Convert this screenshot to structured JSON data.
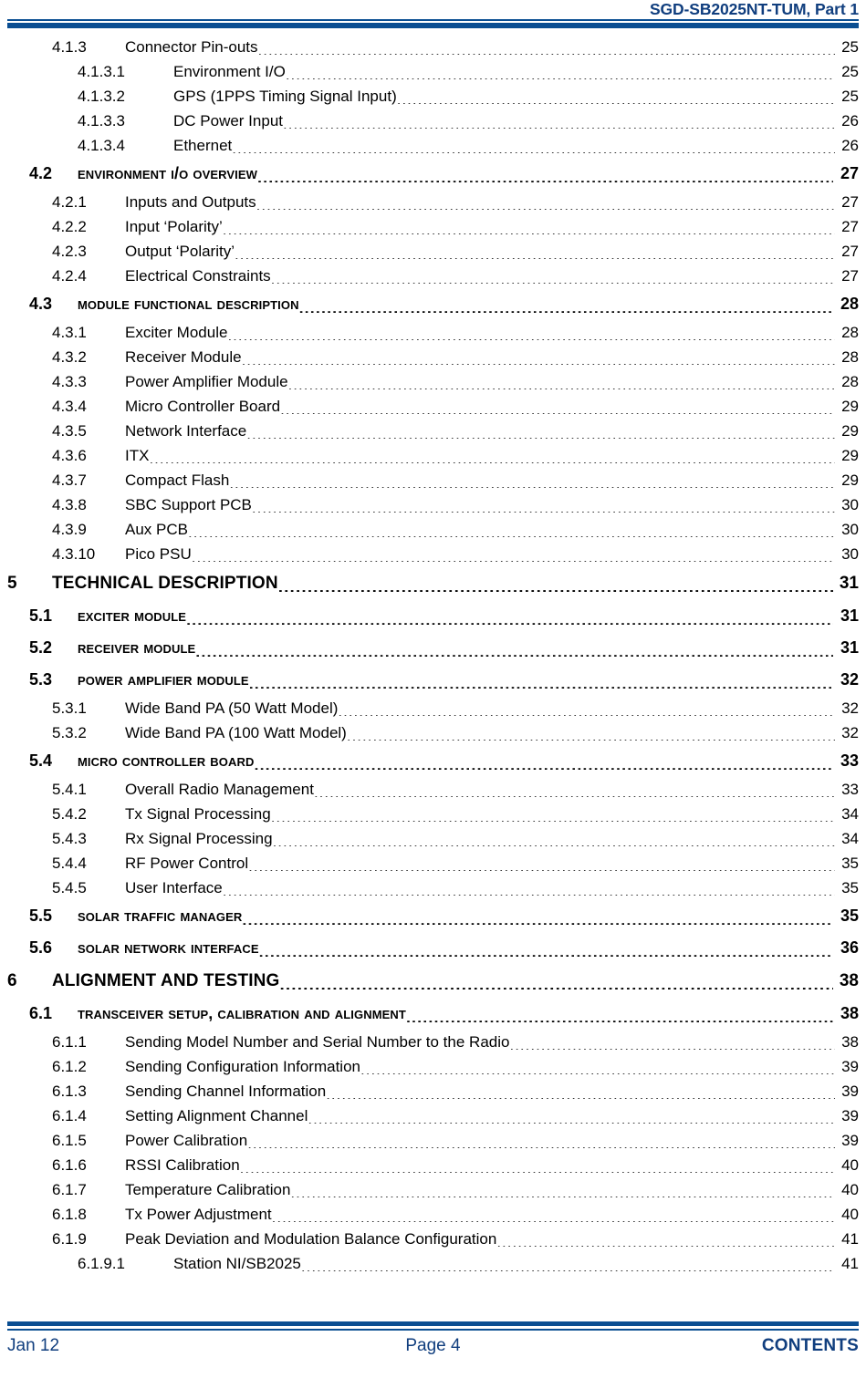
{
  "header": {
    "title": "SGD-SB2025NT-TUM, Part 1",
    "rule_color": "#0A4E92",
    "text_color": "#103E7E"
  },
  "toc": {
    "entries": [
      {
        "level": 3,
        "number": "4.1.3",
        "label": "Connector Pin-outs",
        "page": "25"
      },
      {
        "level": 4,
        "number": "4.1.3.1",
        "label": "Environment I/O",
        "page": "25"
      },
      {
        "level": 4,
        "number": "4.1.3.2",
        "label": "GPS (1PPS Timing Signal Input)",
        "page": "25"
      },
      {
        "level": 4,
        "number": "4.1.3.3",
        "label": "DC Power Input",
        "page": "26"
      },
      {
        "level": 4,
        "number": "4.1.3.4",
        "label": "Ethernet",
        "page": "26"
      },
      {
        "level": 2,
        "number": "4.2",
        "label": "Environment I/O Overview",
        "page": "27"
      },
      {
        "level": 3,
        "number": "4.2.1",
        "label": "Inputs and Outputs",
        "page": "27"
      },
      {
        "level": 3,
        "number": "4.2.2",
        "label": "Input ‘Polarity’",
        "page": "27"
      },
      {
        "level": 3,
        "number": "4.2.3",
        "label": "Output ‘Polarity’",
        "page": "27"
      },
      {
        "level": 3,
        "number": "4.2.4",
        "label": "Electrical Constraints",
        "page": "27"
      },
      {
        "level": 2,
        "number": "4.3",
        "label": "Module Functional Description",
        "page": "28"
      },
      {
        "level": 3,
        "number": "4.3.1",
        "label": "Exciter Module",
        "page": "28"
      },
      {
        "level": 3,
        "number": "4.3.2",
        "label": "Receiver Module",
        "page": "28"
      },
      {
        "level": 3,
        "number": "4.3.3",
        "label": "Power Amplifier Module",
        "page": "28"
      },
      {
        "level": 3,
        "number": "4.3.4",
        "label": "Micro Controller Board",
        "page": "29"
      },
      {
        "level": 3,
        "number": "4.3.5",
        "label": "Network Interface",
        "page": "29"
      },
      {
        "level": 3,
        "number": "4.3.6",
        "label": "ITX",
        "page": "29"
      },
      {
        "level": 3,
        "number": "4.3.7",
        "label": "Compact Flash",
        "page": "29"
      },
      {
        "level": 3,
        "number": "4.3.8",
        "label": "SBC Support PCB",
        "page": "30"
      },
      {
        "level": 3,
        "number": "4.3.9",
        "label": "Aux PCB",
        "page": "30"
      },
      {
        "level": 3,
        "number": "4.3.10",
        "label": "Pico PSU",
        "page": "30"
      },
      {
        "level": 1,
        "number": "5",
        "label": "TECHNICAL DESCRIPTION",
        "page": "31"
      },
      {
        "level": 2,
        "number": "5.1",
        "label": "Exciter Module",
        "page": "31"
      },
      {
        "level": 2,
        "number": "5.2",
        "label": "Receiver Module",
        "page": "31"
      },
      {
        "level": 2,
        "number": "5.3",
        "label": "Power Amplifier Module",
        "page": "32"
      },
      {
        "level": 3,
        "number": "5.3.1",
        "label": "Wide Band PA (50 Watt Model)",
        "page": "32"
      },
      {
        "level": 3,
        "number": "5.3.2",
        "label": "Wide Band PA (100 Watt Model)",
        "page": "32"
      },
      {
        "level": 2,
        "number": "5.4",
        "label": "Micro Controller Board",
        "page": "33"
      },
      {
        "level": 3,
        "number": "5.4.1",
        "label": "Overall Radio Management",
        "page": "33"
      },
      {
        "level": 3,
        "number": "5.4.2",
        "label": "Tx Signal Processing",
        "page": "34"
      },
      {
        "level": 3,
        "number": "5.4.3",
        "label": "Rx Signal Processing",
        "page": "34"
      },
      {
        "level": 3,
        "number": "5.4.4",
        "label": "RF Power Control",
        "page": "35"
      },
      {
        "level": 3,
        "number": "5.4.5",
        "label": "User Interface",
        "page": "35"
      },
      {
        "level": 2,
        "number": "5.5",
        "label": "Solar Traffic Manager",
        "page": "35"
      },
      {
        "level": 2,
        "number": "5.6",
        "label": "Solar Network Interface",
        "page": "36"
      },
      {
        "level": 1,
        "number": "6",
        "label": "ALIGNMENT AND TESTING",
        "page": "38"
      },
      {
        "level": 2,
        "number": "6.1",
        "label": "Transceiver Setup, Calibration and Alignment",
        "page": "38"
      },
      {
        "level": 3,
        "number": "6.1.1",
        "label": "Sending Model Number and Serial Number to the Radio",
        "page": "38"
      },
      {
        "level": 3,
        "number": "6.1.2",
        "label": "Sending Configuration Information",
        "page": "39"
      },
      {
        "level": 3,
        "number": "6.1.3",
        "label": "Sending Channel Information",
        "page": "39"
      },
      {
        "level": 3,
        "number": "6.1.4",
        "label": "Setting Alignment Channel",
        "page": "39"
      },
      {
        "level": 3,
        "number": "6.1.5",
        "label": "Power Calibration",
        "page": "39"
      },
      {
        "level": 3,
        "number": "6.1.6",
        "label": "RSSI Calibration",
        "page": "40"
      },
      {
        "level": 3,
        "number": "6.1.7",
        "label": "Temperature Calibration",
        "page": "40"
      },
      {
        "level": 3,
        "number": "6.1.8",
        "label": "Tx Power Adjustment",
        "page": "40"
      },
      {
        "level": 3,
        "number": "6.1.9",
        "label": "Peak Deviation and Modulation Balance Configuration",
        "page": "41"
      },
      {
        "level": 4,
        "number": "6.1.9.1",
        "label": "Station NI/SB2025",
        "page": "41"
      }
    ]
  },
  "footer": {
    "left": "Jan 12",
    "center": "Page 4",
    "right": "CONTENTS",
    "rule_color": "#0A4E92",
    "text_color": "#103E7E"
  }
}
